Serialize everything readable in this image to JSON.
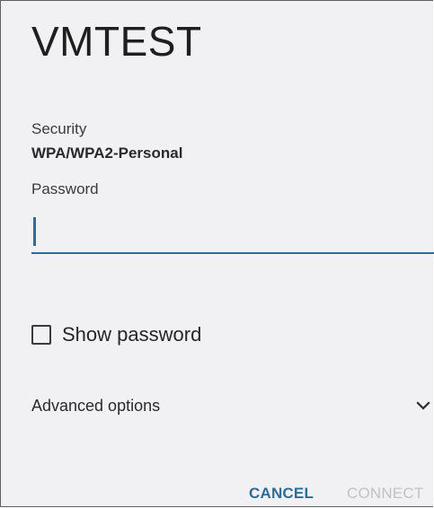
{
  "dialog": {
    "title": "VMTEST",
    "security": {
      "label": "Security",
      "value": "WPA/WPA2-Personal"
    },
    "password": {
      "label": "Password",
      "value": ""
    },
    "show_password": {
      "label": "Show password",
      "checked": false
    },
    "advanced": {
      "label": "Advanced options",
      "icon": "chevron-down-icon"
    },
    "actions": {
      "cancel_label": "CANCEL",
      "connect_label": "CONNECT"
    }
  },
  "colors": {
    "accent": "#2d6c95",
    "disabled": "#c2c2c2",
    "background": "#f1f1f3"
  }
}
